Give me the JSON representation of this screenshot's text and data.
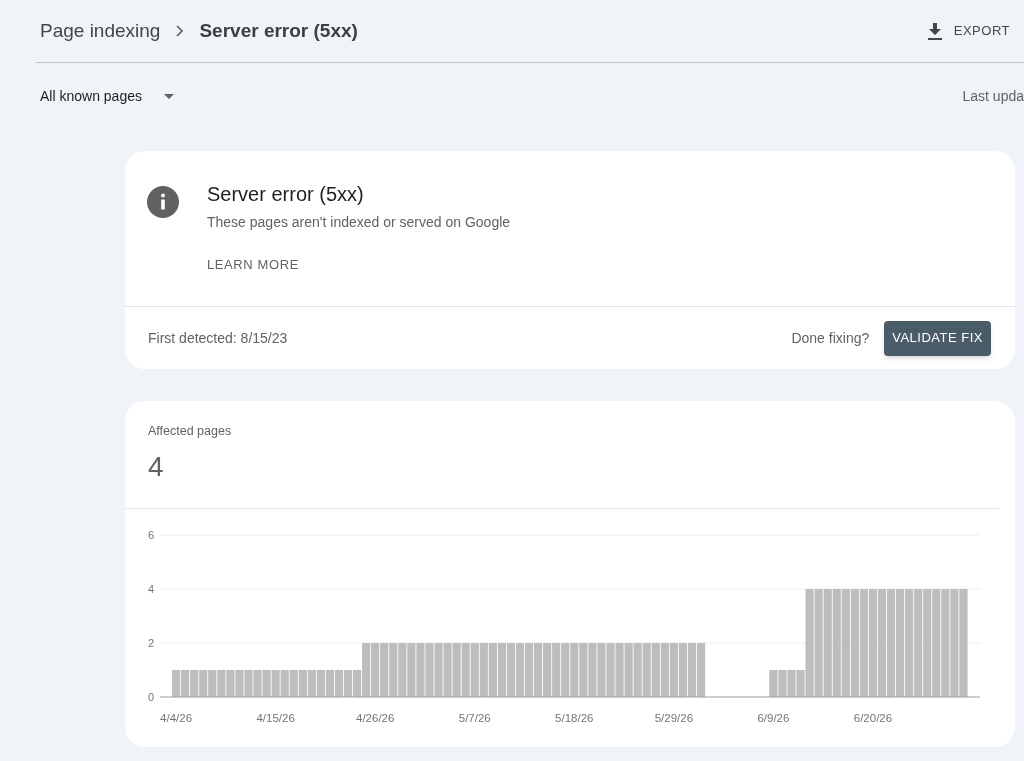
{
  "breadcrumb": {
    "parent": "Page indexing",
    "current": "Server error (5xx)"
  },
  "export_button": {
    "label": "EXPORT"
  },
  "filter": {
    "value": "All known pages"
  },
  "last_updated": "Last upda",
  "issue_card": {
    "title": "Server error (5xx)",
    "description": "These pages aren't indexed or served on Google",
    "learn_more": "LEARN MORE",
    "first_detected": "First detected: 8/15/23",
    "done_fixing": "Done fixing?",
    "validate_button": "VALIDATE FIX"
  },
  "affected_card": {
    "label": "Affected pages",
    "count": "4",
    "chart_data": {
      "type": "bar",
      "categories": [
        "4/4/26",
        null,
        null,
        null,
        null,
        null,
        null,
        null,
        null,
        null,
        null,
        "4/15/26",
        null,
        null,
        null,
        null,
        null,
        null,
        null,
        null,
        null,
        null,
        "4/26/26",
        null,
        null,
        null,
        null,
        null,
        null,
        null,
        null,
        null,
        null,
        "5/7/26",
        null,
        null,
        null,
        null,
        null,
        null,
        null,
        null,
        null,
        null,
        "5/18/26",
        null,
        null,
        null,
        null,
        null,
        null,
        null,
        null,
        null,
        null,
        "5/29/26",
        null,
        null,
        null,
        null,
        null,
        null,
        null,
        null,
        null,
        null,
        "6/9/26",
        null,
        null,
        null,
        null,
        null,
        null,
        null,
        null,
        null,
        null,
        "6/20/26",
        null,
        null,
        null,
        null,
        null,
        null,
        null,
        null,
        null,
        null
      ],
      "values": [
        1,
        1,
        1,
        1,
        1,
        1,
        1,
        1,
        1,
        1,
        1,
        1,
        1,
        1,
        1,
        1,
        1,
        1,
        1,
        1,
        1,
        2,
        2,
        2,
        2,
        2,
        2,
        2,
        2,
        2,
        2,
        2,
        2,
        2,
        2,
        2,
        2,
        2,
        2,
        2,
        2,
        2,
        2,
        2,
        2,
        2,
        2,
        2,
        2,
        2,
        2,
        2,
        2,
        2,
        2,
        2,
        2,
        2,
        2,
        0,
        0,
        0,
        0,
        0,
        0,
        0,
        1,
        1,
        1,
        1,
        4,
        4,
        4,
        4,
        4,
        4,
        4,
        4,
        4,
        4,
        4,
        4,
        4,
        4,
        4,
        4,
        4,
        4
      ],
      "ylim": [
        0,
        6
      ],
      "yticks": [
        0,
        2,
        4,
        6
      ]
    }
  }
}
